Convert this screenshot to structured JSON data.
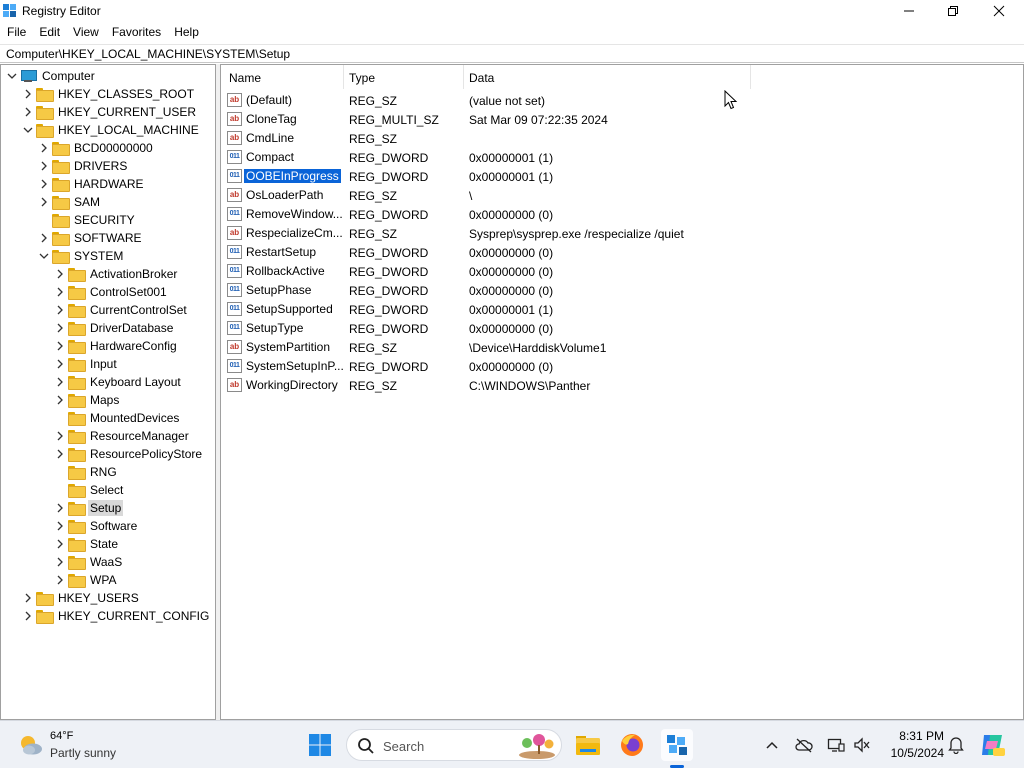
{
  "window": {
    "title": "Registry Editor"
  },
  "menu": [
    "File",
    "Edit",
    "View",
    "Favorites",
    "Help"
  ],
  "address": "Computer\\HKEY_LOCAL_MACHINE\\SYSTEM\\Setup",
  "tree": [
    {
      "label": "Computer",
      "level": 0,
      "chevron": "open",
      "icon": "computer"
    },
    {
      "label": "HKEY_CLASSES_ROOT",
      "level": 1,
      "chevron": "closed"
    },
    {
      "label": "HKEY_CURRENT_USER",
      "level": 1,
      "chevron": "closed"
    },
    {
      "label": "HKEY_LOCAL_MACHINE",
      "level": 1,
      "chevron": "open"
    },
    {
      "label": "BCD00000000",
      "level": 2,
      "chevron": "closed"
    },
    {
      "label": "DRIVERS",
      "level": 2,
      "chevron": "closed"
    },
    {
      "label": "HARDWARE",
      "level": 2,
      "chevron": "closed"
    },
    {
      "label": "SAM",
      "level": 2,
      "chevron": "closed"
    },
    {
      "label": "SECURITY",
      "level": 2,
      "chevron": "none"
    },
    {
      "label": "SOFTWARE",
      "level": 2,
      "chevron": "closed"
    },
    {
      "label": "SYSTEM",
      "level": 2,
      "chevron": "open"
    },
    {
      "label": "ActivationBroker",
      "level": 3,
      "chevron": "closed"
    },
    {
      "label": "ControlSet001",
      "level": 3,
      "chevron": "closed"
    },
    {
      "label": "CurrentControlSet",
      "level": 3,
      "chevron": "closed"
    },
    {
      "label": "DriverDatabase",
      "level": 3,
      "chevron": "closed"
    },
    {
      "label": "HardwareConfig",
      "level": 3,
      "chevron": "closed"
    },
    {
      "label": "Input",
      "level": 3,
      "chevron": "closed"
    },
    {
      "label": "Keyboard Layout",
      "level": 3,
      "chevron": "closed"
    },
    {
      "label": "Maps",
      "level": 3,
      "chevron": "closed"
    },
    {
      "label": "MountedDevices",
      "level": 3,
      "chevron": "none"
    },
    {
      "label": "ResourceManager",
      "level": 3,
      "chevron": "closed"
    },
    {
      "label": "ResourcePolicyStore",
      "level": 3,
      "chevron": "closed"
    },
    {
      "label": "RNG",
      "level": 3,
      "chevron": "none"
    },
    {
      "label": "Select",
      "level": 3,
      "chevron": "none"
    },
    {
      "label": "Setup",
      "level": 3,
      "chevron": "closed",
      "selected": true
    },
    {
      "label": "Software",
      "level": 3,
      "chevron": "closed"
    },
    {
      "label": "State",
      "level": 3,
      "chevron": "closed"
    },
    {
      "label": "WaaS",
      "level": 3,
      "chevron": "closed"
    },
    {
      "label": "WPA",
      "level": 3,
      "chevron": "closed"
    },
    {
      "label": "HKEY_USERS",
      "level": 1,
      "chevron": "closed"
    },
    {
      "label": "HKEY_CURRENT_CONFIG",
      "level": 1,
      "chevron": "closed"
    }
  ],
  "columns": [
    "Name",
    "Type",
    "Data"
  ],
  "values": [
    {
      "name": "(Default)",
      "type": "REG_SZ",
      "data": "(value not set)",
      "icon": "string-value-icon"
    },
    {
      "name": "CloneTag",
      "type": "REG_MULTI_SZ",
      "data": "Sat Mar 09 07:22:35 2024",
      "icon": "string-value-icon"
    },
    {
      "name": "CmdLine",
      "type": "REG_SZ",
      "data": "",
      "icon": "string-value-icon"
    },
    {
      "name": "Compact",
      "type": "REG_DWORD",
      "data": "0x00000001 (1)",
      "icon": "binary-value-icon"
    },
    {
      "name": "OOBEInProgress",
      "type": "REG_DWORD",
      "data": "0x00000001 (1)",
      "icon": "binary-value-icon",
      "selected": true
    },
    {
      "name": "OsLoaderPath",
      "type": "REG_SZ",
      "data": "\\",
      "icon": "string-value-icon"
    },
    {
      "name": "RemoveWindow...",
      "type": "REG_DWORD",
      "data": "0x00000000 (0)",
      "icon": "binary-value-icon"
    },
    {
      "name": "RespecializeCm...",
      "type": "REG_SZ",
      "data": "Sysprep\\sysprep.exe /respecialize /quiet",
      "icon": "string-value-icon"
    },
    {
      "name": "RestartSetup",
      "type": "REG_DWORD",
      "data": "0x00000000 (0)",
      "icon": "binary-value-icon"
    },
    {
      "name": "RollbackActive",
      "type": "REG_DWORD",
      "data": "0x00000000 (0)",
      "icon": "binary-value-icon"
    },
    {
      "name": "SetupPhase",
      "type": "REG_DWORD",
      "data": "0x00000000 (0)",
      "icon": "binary-value-icon"
    },
    {
      "name": "SetupSupported",
      "type": "REG_DWORD",
      "data": "0x00000001 (1)",
      "icon": "binary-value-icon"
    },
    {
      "name": "SetupType",
      "type": "REG_DWORD",
      "data": "0x00000000 (0)",
      "icon": "binary-value-icon"
    },
    {
      "name": "SystemPartition",
      "type": "REG_SZ",
      "data": "\\Device\\HarddiskVolume1",
      "icon": "string-value-icon"
    },
    {
      "name": "SystemSetupInP...",
      "type": "REG_DWORD",
      "data": "0x00000000 (0)",
      "icon": "binary-value-icon"
    },
    {
      "name": "WorkingDirectory",
      "type": "REG_SZ",
      "data": "C:\\WINDOWS\\Panther",
      "icon": "string-value-icon"
    }
  ],
  "taskbar": {
    "weather_temp": "64°F",
    "weather_desc": "Partly sunny",
    "search_placeholder": "Search",
    "time": "8:31 PM",
    "date": "10/5/2024"
  },
  "colors": {
    "selection": "#0a64d8",
    "folder": "#f6c945",
    "taskbar_bg": "#eef1f6"
  }
}
